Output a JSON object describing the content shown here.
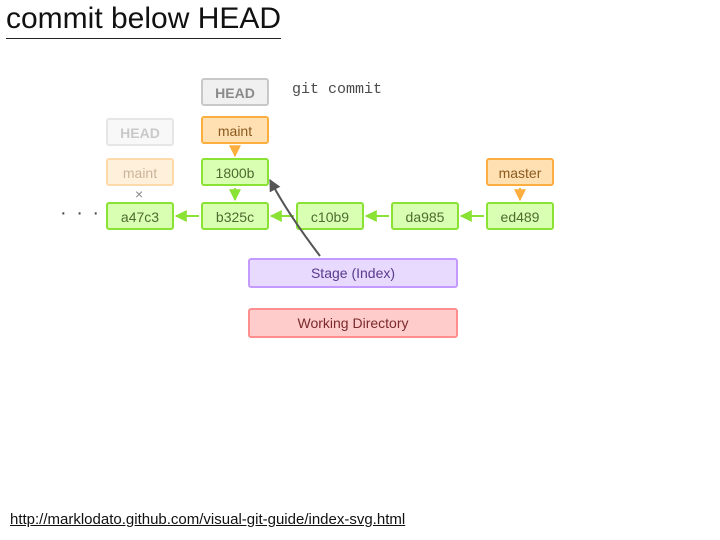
{
  "title": "commit below HEAD",
  "command": "git commit",
  "heads": {
    "old": "HEAD",
    "new": "HEAD"
  },
  "branches": {
    "maint_old": "maint",
    "maint_new": "maint",
    "master": "master"
  },
  "commits": {
    "a47c3": "a47c3",
    "b325c": "b325c",
    "c10b9": "c10b9",
    "da985": "da985",
    "ed489": "ed489",
    "new1800b": "1800b"
  },
  "stage": "Stage (Index)",
  "wd": "Working Directory",
  "dots": "· · ·",
  "xmark": "×",
  "footer": "http://marklodato.github.com/visual-git-guide/index-svg.html",
  "colors": {
    "commit_fill": "#d9ffb3",
    "commit_stroke": "#8ae234",
    "branch_fill": "#ffe0b3",
    "branch_stroke": "#fcaf3e",
    "head_fill": "#f0f0f0",
    "head_stroke": "#c8c8c8",
    "stage_fill": "#e8d9ff",
    "stage_stroke": "#c49aff",
    "wd_fill": "#ffcccc",
    "wd_stroke": "#ff8f8f"
  },
  "chart_data": {
    "type": "diagram",
    "title": "commit below HEAD",
    "nodes": [
      {
        "id": "a47c3",
        "kind": "commit"
      },
      {
        "id": "b325c",
        "kind": "commit"
      },
      {
        "id": "c10b9",
        "kind": "commit"
      },
      {
        "id": "da985",
        "kind": "commit"
      },
      {
        "id": "ed489",
        "kind": "commit"
      },
      {
        "id": "1800b",
        "kind": "commit",
        "new": true
      },
      {
        "id": "maint_old",
        "kind": "branch",
        "label": "maint",
        "ghost": true,
        "points_to": "b325c",
        "removed": true
      },
      {
        "id": "maint_new",
        "kind": "branch",
        "label": "maint",
        "points_to": "1800b"
      },
      {
        "id": "master",
        "kind": "branch",
        "label": "master",
        "points_to": "ed489"
      },
      {
        "id": "head_old",
        "kind": "head",
        "ghost": true,
        "points_to": "maint_old"
      },
      {
        "id": "head_new",
        "kind": "head",
        "points_to": "maint_new"
      },
      {
        "id": "stage",
        "kind": "stage",
        "label": "Stage (Index)"
      },
      {
        "id": "wd",
        "kind": "working_directory",
        "label": "Working Directory"
      }
    ],
    "edges": [
      {
        "from": "b325c",
        "to": "a47c3",
        "kind": "parent"
      },
      {
        "from": "c10b9",
        "to": "b325c",
        "kind": "parent"
      },
      {
        "from": "da985",
        "to": "c10b9",
        "kind": "parent"
      },
      {
        "from": "ed489",
        "to": "da985",
        "kind": "parent"
      },
      {
        "from": "1800b",
        "to": "b325c",
        "kind": "parent"
      },
      {
        "from": "maint_new",
        "to": "1800b",
        "kind": "ref"
      },
      {
        "from": "head_new",
        "to": "maint_new",
        "kind": "ref"
      },
      {
        "from": "master",
        "to": "ed489",
        "kind": "ref"
      },
      {
        "from": "stage",
        "to": "1800b",
        "kind": "produces",
        "label": "git commit"
      },
      {
        "from": "wd",
        "to": "stage",
        "kind": "flow"
      }
    ]
  }
}
